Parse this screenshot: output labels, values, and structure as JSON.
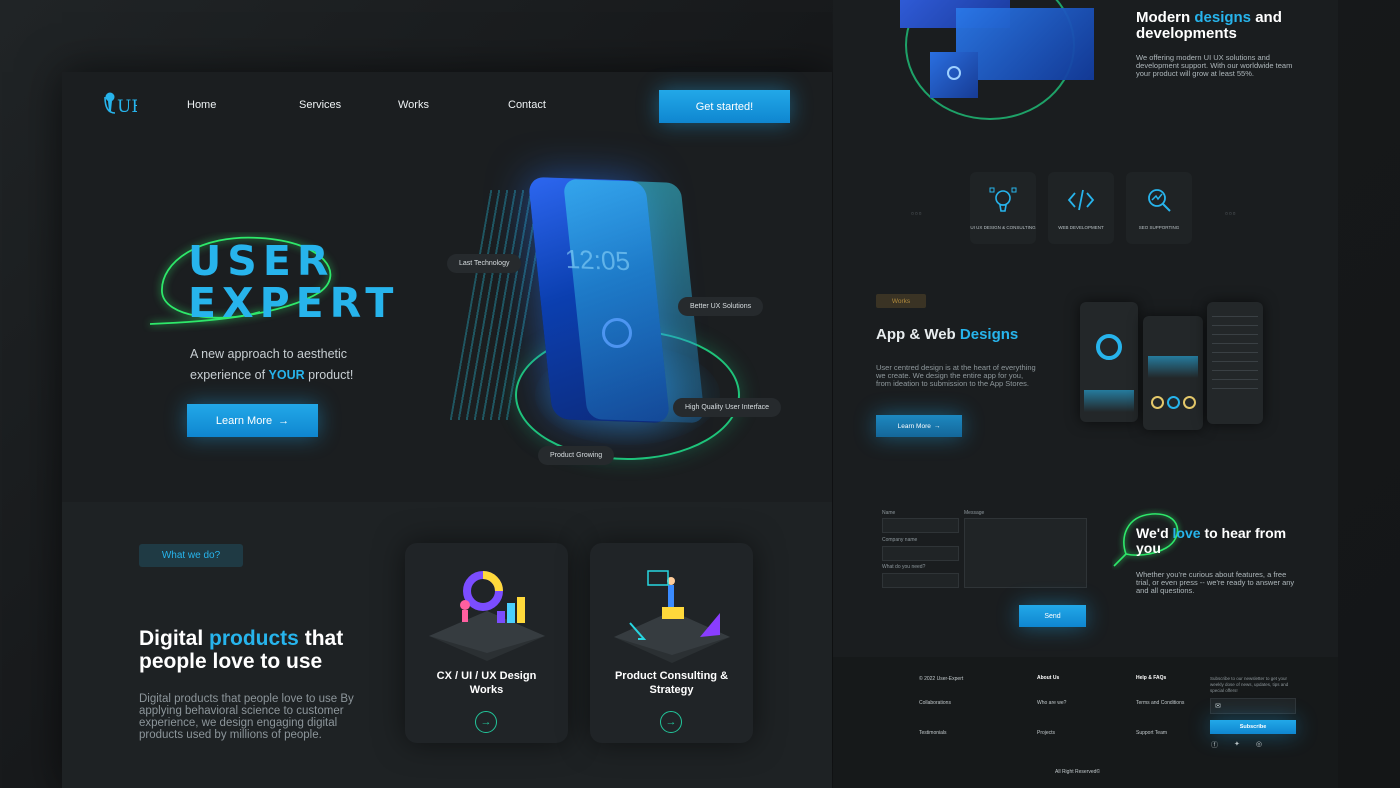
{
  "nav": {
    "logo": "UE",
    "links": [
      "Home",
      "Services",
      "Works",
      "Contact"
    ],
    "cta": "Get started!"
  },
  "hero": {
    "title_line1": "USER",
    "title_line2": "EXPERT",
    "subtitle_before": "A new approach to aesthetic experience of",
    "subtitle_highlight": "YOUR",
    "subtitle_after": "product!",
    "button": "Learn More",
    "tags": [
      "Last Technology",
      "Better UX Solutions",
      "High Quality User Interface",
      "Product Growing"
    ],
    "phone_time": "12:05"
  },
  "whatwedo": {
    "badge": "What we do?",
    "title_before": "Digital",
    "title_highlight": "products",
    "title_after": "that people love to use",
    "description": "Digital products that people love to use By applying behavioral science to customer experience, we design engaging digital products used by millions of people.",
    "cards": [
      {
        "label": "CX / UI / UX  Design Works"
      },
      {
        "label": "Product Consulting & Strategy"
      }
    ]
  },
  "modern": {
    "title_before": "Modern",
    "title_highlight": "designs",
    "title_after": "and developments",
    "description": "We offering modern UI UX solutions and development support. With our worldwide team your product will grow at least 55%."
  },
  "services": [
    {
      "label": "UI UX DESIGN & CONSULTING"
    },
    {
      "label": "WEB DEVELOPMENT"
    },
    {
      "label": "SEO SUPPORTING"
    }
  ],
  "works": {
    "badge": "Works",
    "title_before": "App & Web",
    "title_highlight": "Designs",
    "description": "User centred design is at the heart of everything we create. We design the entire app for you, from ideation to submission to the App Stores.",
    "button": "Learn More"
  },
  "contact": {
    "name_label": "Name",
    "company_label": "Company name",
    "need_label": "What do you need?",
    "message_label": "Message",
    "send": "Send",
    "title_before": "We'd",
    "title_highlight": "love",
    "title_after": "to hear from you",
    "description": "Whether you're curious about features, a free trial, or even press -- we're ready to answer any and all questions."
  },
  "footer": {
    "copyright": "© 2022 User-Expert",
    "col1": [
      "Collaborations",
      "Testimonials"
    ],
    "about_title": "About Us",
    "col2": [
      "Who are we?",
      "Projects"
    ],
    "help_title": "Help & FAQs",
    "col3": [
      "Terms and Conditions",
      "Support Team"
    ],
    "newsletter": "Subscribe to our newsletter to get your weekly dose of news, updates, tips and special offers!",
    "subscribe": "Subscribe",
    "rights": "All Right Reserved©"
  },
  "colors": {
    "accent": "#27b4ec",
    "green": "#1fc47a"
  }
}
